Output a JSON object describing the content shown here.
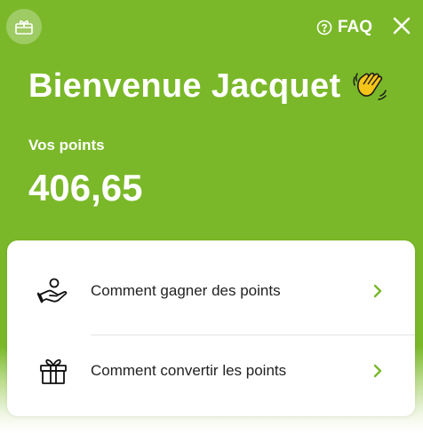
{
  "header": {
    "faq_label": "FAQ",
    "gift_icon": "gift-card-icon",
    "close_icon": "close-icon",
    "help_icon": "question-circle-icon"
  },
  "hero": {
    "welcome_text": "Bienvenue Jacquet",
    "wave_emoji": "👋",
    "points_label": "Vos points",
    "points_value": "406,65"
  },
  "menu": {
    "items": [
      {
        "label": "Comment gagner des points",
        "icon": "hand-coin-icon"
      },
      {
        "label": "Comment convertir les points",
        "icon": "gift-icon"
      }
    ]
  },
  "colors": {
    "brand_green": "#7ab829",
    "chevron_green": "#7ab829",
    "text_dark": "#222222"
  }
}
